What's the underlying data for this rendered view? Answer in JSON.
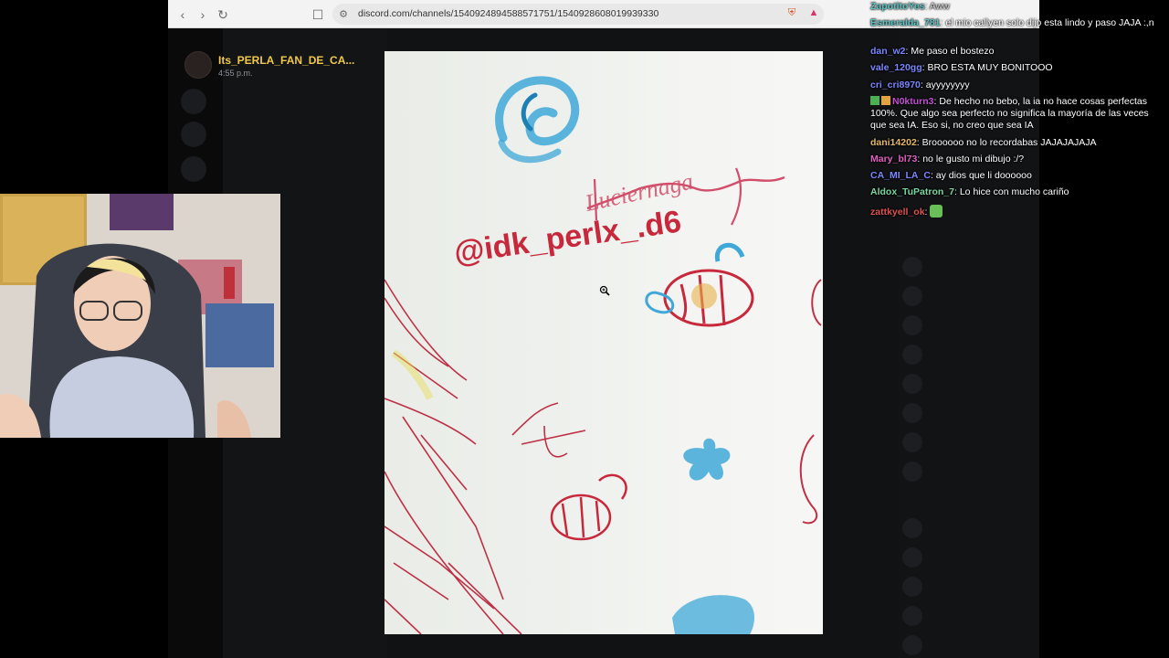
{
  "browser": {
    "url": "discord.com/channels/1540924894588571751/1540928608019939330",
    "back_icon": "chevron-left-icon",
    "forward_icon": "chevron-right-icon",
    "reload_icon": "reload-icon"
  },
  "viewer": {
    "author": "Its_PERLA_FAN_DE_CA...",
    "timestamp": "4:55 p.m."
  },
  "chat": [
    {
      "user": "ZapotitoYes",
      "color": "#5cc0c0",
      "text": "Aww"
    },
    {
      "user": "Esmeralda_781",
      "color": "#5cc0c0",
      "text": "el mio callyen solo dijo esta lindo y paso JAJA :,n"
    },
    {
      "user": "dan_w2",
      "color": "#7a86ff",
      "text": "Me paso el bostezo"
    },
    {
      "user": "vale_120gg",
      "color": "#7a86ff",
      "text": "BRO ESTA MUY BONITOOO"
    },
    {
      "user": "cri_cri8970",
      "color": "#7a86ff",
      "text": "ayyyyyyyy"
    },
    {
      "user": "N0kturn3",
      "color": "#c44dd6",
      "text": "De hecho no bebo, la ia no hace cosas perfectas 100%. Que algo sea perfecto no significa la mayoría de las veces que sea IA. Eso si, no creo que sea IA"
    },
    {
      "user": "dani14202",
      "color": "#e6b86a",
      "text": "Broooooo no lo recordabas JAJAJAJAJA"
    },
    {
      "user": "Mary_bl73",
      "color": "#e060c0",
      "text": "no le gusto mi dibujo :/?"
    },
    {
      "user": "CA_MI_LA_C",
      "color": "#7a86ff",
      "text": "ay dios que li doooooo"
    },
    {
      "user": "Aldox_TuPatron_7",
      "color": "#7ad6a0",
      "text": "Lo hice con mucho cariño"
    },
    {
      "user": "zattkyell_ok",
      "color": "#e05050",
      "text": ""
    }
  ],
  "drawing_text": {
    "handle": "@idk_perlx_.d6",
    "signature": "Luciernaga"
  },
  "colors": {
    "accent_gold": "#f0c94a",
    "blue_crayon": "#3fa8d8",
    "red_ink": "#c8283c"
  }
}
